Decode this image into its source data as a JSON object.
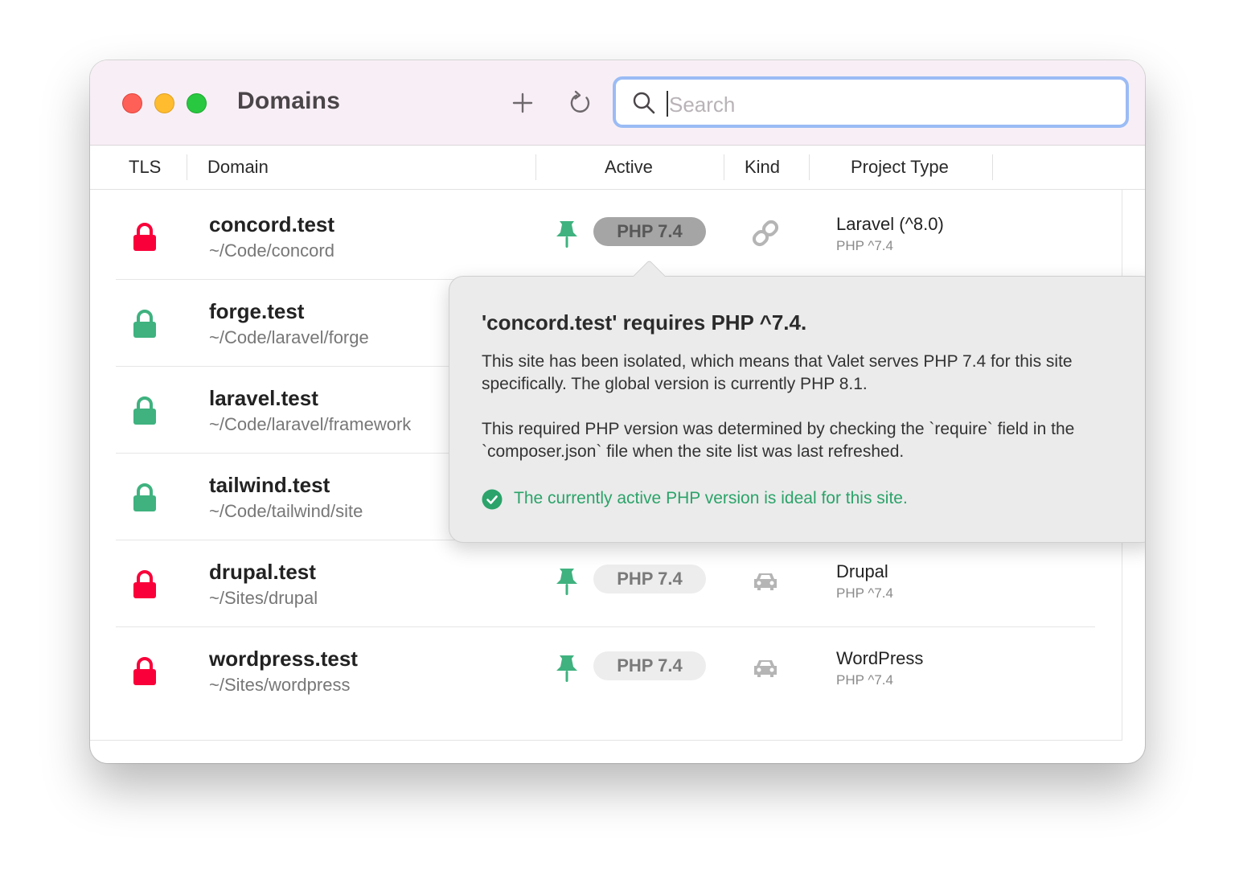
{
  "window": {
    "title": "Domains"
  },
  "toolbar": {
    "add_icon": "plus-icon",
    "refresh_icon": "refresh-icon"
  },
  "search": {
    "placeholder": "Search",
    "value": ""
  },
  "columns": {
    "tls": "TLS",
    "domain": "Domain",
    "active": "Active",
    "kind": "Kind",
    "project_type": "Project Type"
  },
  "colors": {
    "locked": "#f9003a",
    "secure": "#3fb27f",
    "success": "#2ba36a",
    "search_focus": "#9bbcf5"
  },
  "rows": [
    {
      "name": "concord.test",
      "path": "~/Code/concord",
      "tls": "insecure",
      "php": "PHP 7.4",
      "kind": "link-icon",
      "project": "Laravel (^8.0)",
      "requires": "PHP ^7.4"
    },
    {
      "name": "forge.test",
      "path": "~/Code/laravel/forge",
      "tls": "secure"
    },
    {
      "name": "laravel.test",
      "path": "~/Code/laravel/framework",
      "tls": "secure"
    },
    {
      "name": "tailwind.test",
      "path": "~/Code/tailwind/site",
      "tls": "secure"
    },
    {
      "name": "drupal.test",
      "path": "~/Sites/drupal",
      "tls": "insecure",
      "php": "PHP 7.4",
      "kind": "car-icon",
      "project": "Drupal",
      "requires": "PHP ^7.4"
    },
    {
      "name": "wordpress.test",
      "path": "~/Sites/wordpress",
      "tls": "insecure",
      "php": "PHP 7.4",
      "kind": "car-icon",
      "project": "WordPress",
      "requires": "PHP ^7.4"
    }
  ],
  "popover": {
    "title": "'concord.test' requires PHP ^7.4.",
    "paragraph1": "This site has been isolated, which means that Valet serves PHP 7.4 for this site specifically. The global version is currently PHP 8.1.",
    "paragraph2": "This required PHP version was determined by checking the `require` field in the `composer.json` file when the site list was last refreshed.",
    "status": "The currently active PHP version is ideal for this site."
  }
}
